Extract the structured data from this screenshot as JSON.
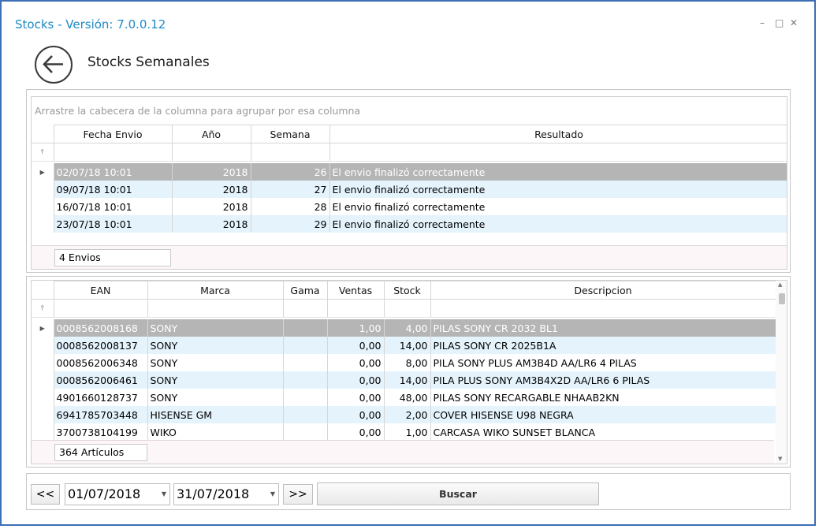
{
  "window": {
    "title": "Stocks - Versión: 7.0.0.12",
    "controls": {
      "minimize": "–",
      "maximize": "□",
      "close": "✕"
    }
  },
  "page": {
    "title": "Stocks Semanales",
    "back_icon": "arrow-left-circle-icon"
  },
  "envios": {
    "group_hint": "Arrastre la cabecera de la columna para agrupar por esa columna",
    "columns": [
      "Fecha Envio",
      "Año",
      "Semana",
      "Resultado"
    ],
    "rows": [
      {
        "fecha": "02/07/18 10:01",
        "anio": "2018",
        "semana": "26",
        "resultado": "El envio finalizó correctamente"
      },
      {
        "fecha": "09/07/18 10:01",
        "anio": "2018",
        "semana": "27",
        "resultado": "El envio finalizó correctamente"
      },
      {
        "fecha": "16/07/18 10:01",
        "anio": "2018",
        "semana": "28",
        "resultado": "El envio finalizó correctamente"
      },
      {
        "fecha": "23/07/18 10:01",
        "anio": "2018",
        "semana": "29",
        "resultado": "El envio finalizó correctamente"
      }
    ],
    "footer": "4 Envios"
  },
  "articulos": {
    "columns": [
      "EAN",
      "Marca",
      "Gama",
      "Ventas",
      "Stock",
      "Descripcion"
    ],
    "rows": [
      {
        "ean": "0008562008168",
        "marca": "SONY",
        "gama": "",
        "ventas": "1,00",
        "stock": "4,00",
        "desc": "PILAS SONY CR 2032 BL1"
      },
      {
        "ean": "0008562008137",
        "marca": "SONY",
        "gama": "",
        "ventas": "0,00",
        "stock": "14,00",
        "desc": "PILAS SONY CR 2025B1A"
      },
      {
        "ean": "0008562006348",
        "marca": "SONY",
        "gama": "",
        "ventas": "0,00",
        "stock": "8,00",
        "desc": "PILA SONY PLUS AM3B4D AA/LR6 4 PILAS"
      },
      {
        "ean": "0008562006461",
        "marca": "SONY",
        "gama": "",
        "ventas": "0,00",
        "stock": "14,00",
        "desc": "PILA PLUS SONY AM3B4X2D AA/LR6 6 PILAS"
      },
      {
        "ean": "4901660128737",
        "marca": "SONY",
        "gama": "",
        "ventas": "0,00",
        "stock": "48,00",
        "desc": "PILAS SONY RECARGABLE NHAAB2KN"
      },
      {
        "ean": "6941785703448",
        "marca": "HISENSE GM",
        "gama": "",
        "ventas": "0,00",
        "stock": "2,00",
        "desc": "COVER HISENSE U98 NEGRA"
      },
      {
        "ean": "3700738104199",
        "marca": "WIKO",
        "gama": "",
        "ventas": "0,00",
        "stock": "1,00",
        "desc": "CARCASA WIKO SUNSET BLANCA"
      }
    ],
    "footer": "364 Artículos"
  },
  "toolbar": {
    "prev_label": "<<",
    "next_label": ">>",
    "date_from": "01/07/2018",
    "date_to": "31/07/2018",
    "search_label": "Buscar"
  }
}
